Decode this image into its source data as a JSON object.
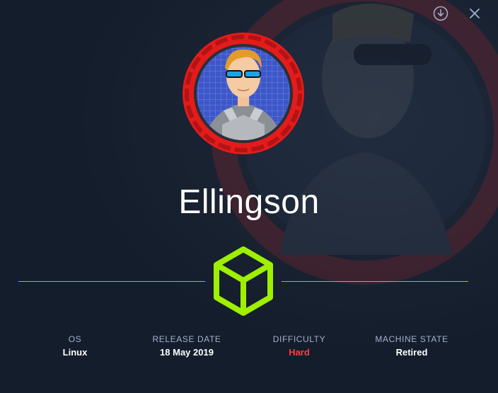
{
  "machine": {
    "name": "Ellingson"
  },
  "stats": [
    {
      "label": "OS",
      "value": "Linux",
      "color": "#ffffff"
    },
    {
      "label": "RELEASE DATE",
      "value": "18 May 2019",
      "color": "#ffffff"
    },
    {
      "label": "DIFFICULTY",
      "value": "Hard",
      "color": "#ff3e3e"
    },
    {
      "label": "MACHINE STATE",
      "value": "Retired",
      "color": "#ffffff"
    }
  ],
  "toolbar": {
    "download_icon": "download-icon",
    "close_icon": "close-icon"
  },
  "colors": {
    "background": "#141d2b",
    "accent": "#9fef00",
    "ring": "#e51b1b",
    "hard": "#ff3e3e"
  }
}
